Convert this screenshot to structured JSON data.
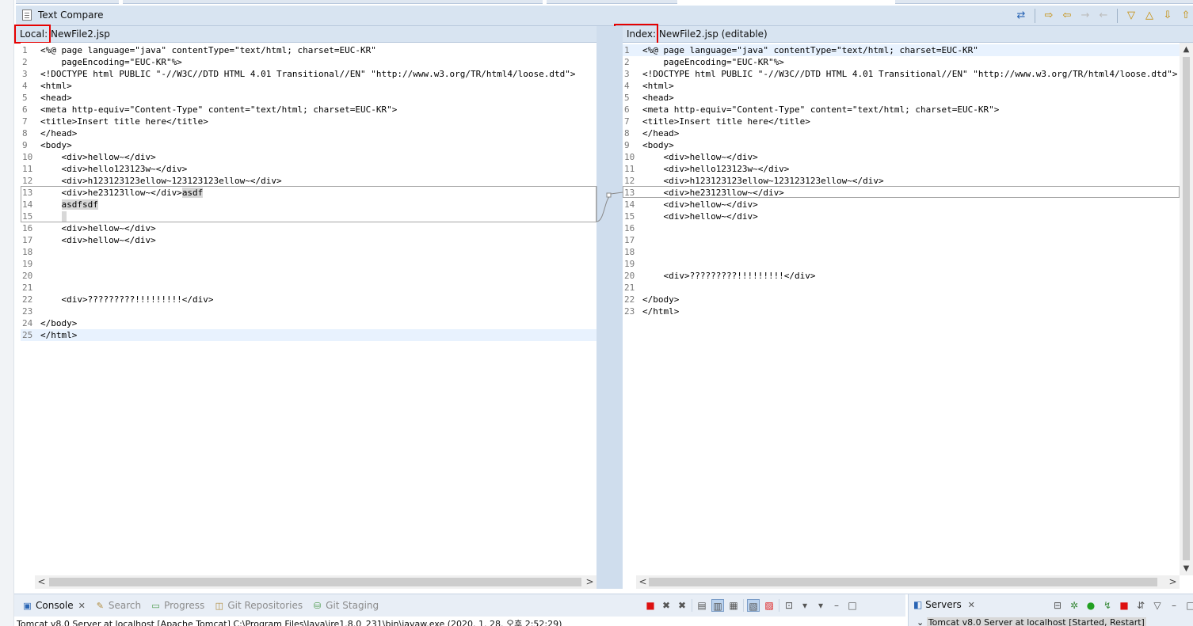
{
  "toolbar": {
    "title": "Text Compare"
  },
  "left_pane": {
    "prefix": "Local:",
    "file": "NewFile2.jsp",
    "lines": [
      {
        "n": "1",
        "code": "<%@ page language=\"java\" contentType=\"text/html; charset=EUC-KR\""
      },
      {
        "n": "2",
        "code": "    pageEncoding=\"EUC-KR\"%>"
      },
      {
        "n": "3",
        "code": "<!DOCTYPE html PUBLIC \"-//W3C//DTD HTML 4.01 Transitional//EN\" \"http://www.w3.org/TR/html4/loose.dtd\">"
      },
      {
        "n": "4",
        "code": "<html>"
      },
      {
        "n": "5",
        "code": "<head>"
      },
      {
        "n": "6",
        "code": "<meta http-equiv=\"Content-Type\" content=\"text/html; charset=EUC-KR\">"
      },
      {
        "n": "7",
        "code": "<title>Insert title here</title>"
      },
      {
        "n": "8",
        "code": "</head>"
      },
      {
        "n": "9",
        "code": "<body>"
      },
      {
        "n": "10",
        "code": "    <div>hellow~</div>"
      },
      {
        "n": "11",
        "code": "    <div>hello123123w~</div>"
      },
      {
        "n": "12",
        "code": "    <div>h123123123ellow~123123123ellow~</div>"
      },
      {
        "n": "13",
        "code": "    <div>he23123llow~</div>",
        "extra": "asdf"
      },
      {
        "n": "14",
        "code": "    ",
        "extra": "asdfsdf"
      },
      {
        "n": "15",
        "code": "    ",
        "extra": " "
      },
      {
        "n": "16",
        "code": "    <div>hellow~</div>"
      },
      {
        "n": "17",
        "code": "    <div>hellow~</div>"
      },
      {
        "n": "18",
        "code": ""
      },
      {
        "n": "19",
        "code": ""
      },
      {
        "n": "20",
        "code": ""
      },
      {
        "n": "21",
        "code": ""
      },
      {
        "n": "22",
        "code": "    <div>?????????!!!!!!!!!</div>"
      },
      {
        "n": "23",
        "code": ""
      },
      {
        "n": "24",
        "code": "</body>"
      },
      {
        "n": "25",
        "code": "</html>"
      }
    ]
  },
  "right_pane": {
    "prefix": "Index:",
    "file": "NewFile2.jsp (editable)",
    "lines": [
      {
        "n": "1",
        "code": "<%@ page language=\"java\" contentType=\"text/html; charset=EUC-KR\""
      },
      {
        "n": "2",
        "code": "    pageEncoding=\"EUC-KR\"%>"
      },
      {
        "n": "3",
        "code": "<!DOCTYPE html PUBLIC \"-//W3C//DTD HTML 4.01 Transitional//EN\" \"http://www.w3.org/TR/html4/loose.dtd\">"
      },
      {
        "n": "4",
        "code": "<html>"
      },
      {
        "n": "5",
        "code": "<head>"
      },
      {
        "n": "6",
        "code": "<meta http-equiv=\"Content-Type\" content=\"text/html; charset=EUC-KR\">"
      },
      {
        "n": "7",
        "code": "<title>Insert title here</title>"
      },
      {
        "n": "8",
        "code": "</head>"
      },
      {
        "n": "9",
        "code": "<body>"
      },
      {
        "n": "10",
        "code": "    <div>hellow~</div>"
      },
      {
        "n": "11",
        "code": "    <div>hello123123w~</div>"
      },
      {
        "n": "12",
        "code": "    <div>h123123123ellow~123123123ellow~</div>"
      },
      {
        "n": "13",
        "code": "    <div>he23123llow~</div>"
      },
      {
        "n": "14",
        "code": "    <div>hellow~</div>"
      },
      {
        "n": "15",
        "code": "    <div>hellow~</div>"
      },
      {
        "n": "16",
        "code": ""
      },
      {
        "n": "17",
        "code": ""
      },
      {
        "n": "18",
        "code": ""
      },
      {
        "n": "19",
        "code": ""
      },
      {
        "n": "20",
        "code": "    <div>?????????!!!!!!!!!</div>"
      },
      {
        "n": "21",
        "code": ""
      },
      {
        "n": "22",
        "code": "</body>"
      },
      {
        "n": "23",
        "code": "</html>"
      }
    ]
  },
  "bottom": {
    "tabs": [
      {
        "label": "Console",
        "icon": "console-icon",
        "active": true,
        "closable": true
      },
      {
        "label": "Search",
        "icon": "search-icon",
        "active": false
      },
      {
        "label": "Progress",
        "icon": "progress-icon",
        "active": false
      },
      {
        "label": "Git Repositories",
        "icon": "git-repositories-icon",
        "active": false
      },
      {
        "label": "Git Staging",
        "icon": "git-staging-icon",
        "active": false
      }
    ],
    "console_text": "Tomcat v8.0 Server at localhost [Apache Tomcat] C:\\Program Files\\Java\\jre1.8.0_231\\bin\\javaw.exe (2020. 1. 28. 오후 2:52:29)",
    "servers_tab": "Servers",
    "servers_row": "Tomcat v8.0 Server at localhost  [Started, Restart]"
  }
}
